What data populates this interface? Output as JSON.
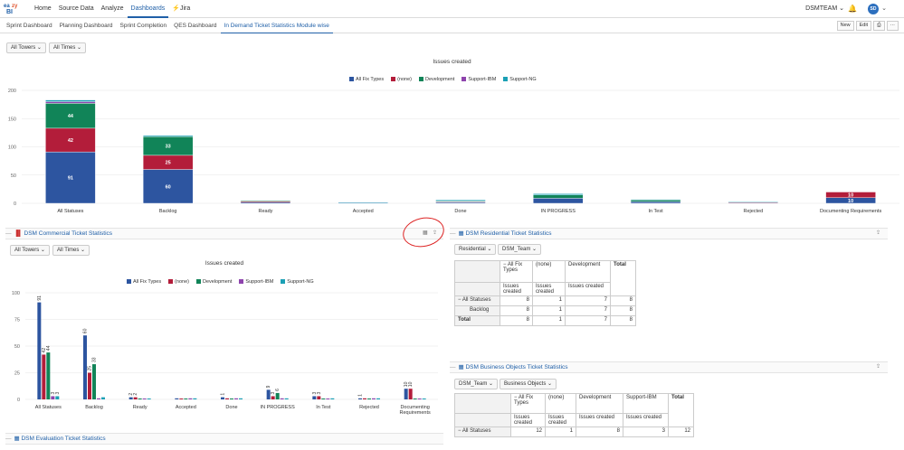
{
  "topnav": {
    "items": [
      "Home",
      "Source Data",
      "Analyze",
      "Dashboards"
    ],
    "jira": "Jira",
    "team": "DSMTEAM",
    "avatar": "SD"
  },
  "tabs": {
    "items": [
      "Sprint Dashboard",
      "Planning Dashboard",
      "Sprint Completion",
      "QES Dashboard",
      "In Demand Ticket Statistics Module wise"
    ],
    "buttons": [
      "New",
      "Edit",
      "⎙",
      "···"
    ]
  },
  "main_filters": [
    "All Towers",
    "All Times"
  ],
  "main_chart": {
    "title": "Issues created"
  },
  "legend": [
    "All Fix Types",
    "(none)",
    "Development",
    "Support-IBM",
    "Support-NG"
  ],
  "colors": {
    "all": "#2d55a0",
    "none": "#b31d3a",
    "dev": "#118458",
    "ibm": "#8e44ad",
    "ng": "#1ba0b5",
    "accent": "#2060a8"
  },
  "chart_data": [
    {
      "type": "bar",
      "title": "Issues created",
      "stacked": true,
      "categories": [
        "All Statuses",
        "Backlog",
        "Ready",
        "Accepted",
        "Done",
        "IN PROGRESS",
        "In Test",
        "Rejected",
        "Documenting Requirements"
      ],
      "ylim": [
        0,
        200
      ],
      "yticks": [
        0,
        50,
        100,
        150,
        200
      ],
      "series": [
        {
          "name": "All Fix Types",
          "values": [
            91,
            60,
            2,
            1,
            2,
            9,
            3,
            1,
            10
          ]
        },
        {
          "name": "(none)",
          "values": [
            42,
            25,
            2,
            0,
            1,
            0,
            0,
            1,
            10
          ]
        },
        {
          "name": "Development",
          "values": [
            44,
            33,
            1,
            0,
            1,
            6,
            3,
            0,
            0
          ]
        },
        {
          "name": "Support-IBM",
          "values": [
            3,
            0,
            0,
            0,
            0,
            0,
            0,
            0,
            0
          ]
        },
        {
          "name": "Support-NG",
          "values": [
            3,
            2,
            0,
            1,
            2,
            2,
            1,
            1,
            0
          ]
        }
      ],
      "data_labels": [
        [
          "91",
          "42",
          "44",
          "3"
        ],
        [
          "60",
          "25",
          "33",
          "0"
        ],
        [],
        [],
        [],
        [
          "9",
          "6"
        ],
        [],
        [],
        [
          "10",
          "10"
        ]
      ]
    },
    {
      "type": "bar",
      "title": "Issues created",
      "stacked": false,
      "categories": [
        "All Statuses",
        "Backlog",
        "Ready",
        "Accepted",
        "Done",
        "IN PROGRESS",
        "In Test",
        "Rejected",
        "Documenting Requirements"
      ],
      "ylim": [
        0,
        100
      ],
      "yticks": [
        0,
        25,
        50,
        75,
        100
      ],
      "series": [
        {
          "name": "All Fix Types",
          "values": [
            91,
            60,
            2,
            1,
            2,
            9,
            3,
            1,
            10
          ]
        },
        {
          "name": "(none)",
          "values": [
            42,
            25,
            2,
            0,
            1,
            3,
            3,
            1,
            10
          ]
        },
        {
          "name": "Development",
          "values": [
            44,
            33,
            0,
            0,
            0,
            6,
            0,
            0,
            0
          ]
        },
        {
          "name": "Support-IBM",
          "values": [
            3,
            1,
            0,
            1,
            1,
            1,
            0,
            1,
            0
          ]
        },
        {
          "name": "Support-NG",
          "values": [
            3,
            2,
            0,
            1,
            1,
            1,
            1,
            1,
            0
          ]
        }
      ],
      "bar_labels": [
        [
          "91",
          "42",
          "44",
          "3",
          "3"
        ],
        [
          "60",
          "25",
          "33"
        ],
        [
          "2",
          "2"
        ],
        [],
        [
          "1"
        ],
        [
          "9",
          "3",
          "6"
        ],
        [
          "3",
          "3"
        ],
        [
          "1"
        ],
        [
          "10",
          "10"
        ]
      ]
    }
  ],
  "commercial": {
    "title": "DSM Commercial Ticket Statistics",
    "filters": [
      "All Towers",
      "All Times"
    ],
    "chart_title": "Issues created"
  },
  "residential": {
    "title": "DSM Residential Ticket Statistics",
    "filters": [
      "Residential",
      "DSM_Team"
    ],
    "header": [
      "− All Fix Types",
      "(none)",
      "Development",
      "Total"
    ],
    "sub": [
      "Issues created",
      "Issues created",
      "Issues created"
    ],
    "rows": [
      {
        "label": "− All Statuses",
        "values": [
          "8",
          "1",
          "7",
          "8"
        ]
      },
      {
        "label": "Backlog",
        "values": [
          "8",
          "1",
          "7",
          "8"
        ]
      },
      {
        "label": "Total",
        "values": [
          "8",
          "1",
          "7",
          "8"
        ]
      }
    ]
  },
  "business": {
    "title": "DSM Business Objects Ticket Statistics",
    "filters": [
      "DSM_Team",
      "Business Objects"
    ],
    "header": [
      "− All Fix Types",
      "(none)",
      "Development",
      "Support-IBM",
      "Total"
    ],
    "sub": [
      "Issues created",
      "Issues created",
      "Issues created",
      "Issues created"
    ],
    "rows": [
      {
        "label": "− All Statuses",
        "values": [
          "12",
          "1",
          "8",
          "3",
          "12"
        ]
      }
    ]
  },
  "evaluation": {
    "title": "DSM Evaluation Ticket Statistics"
  }
}
